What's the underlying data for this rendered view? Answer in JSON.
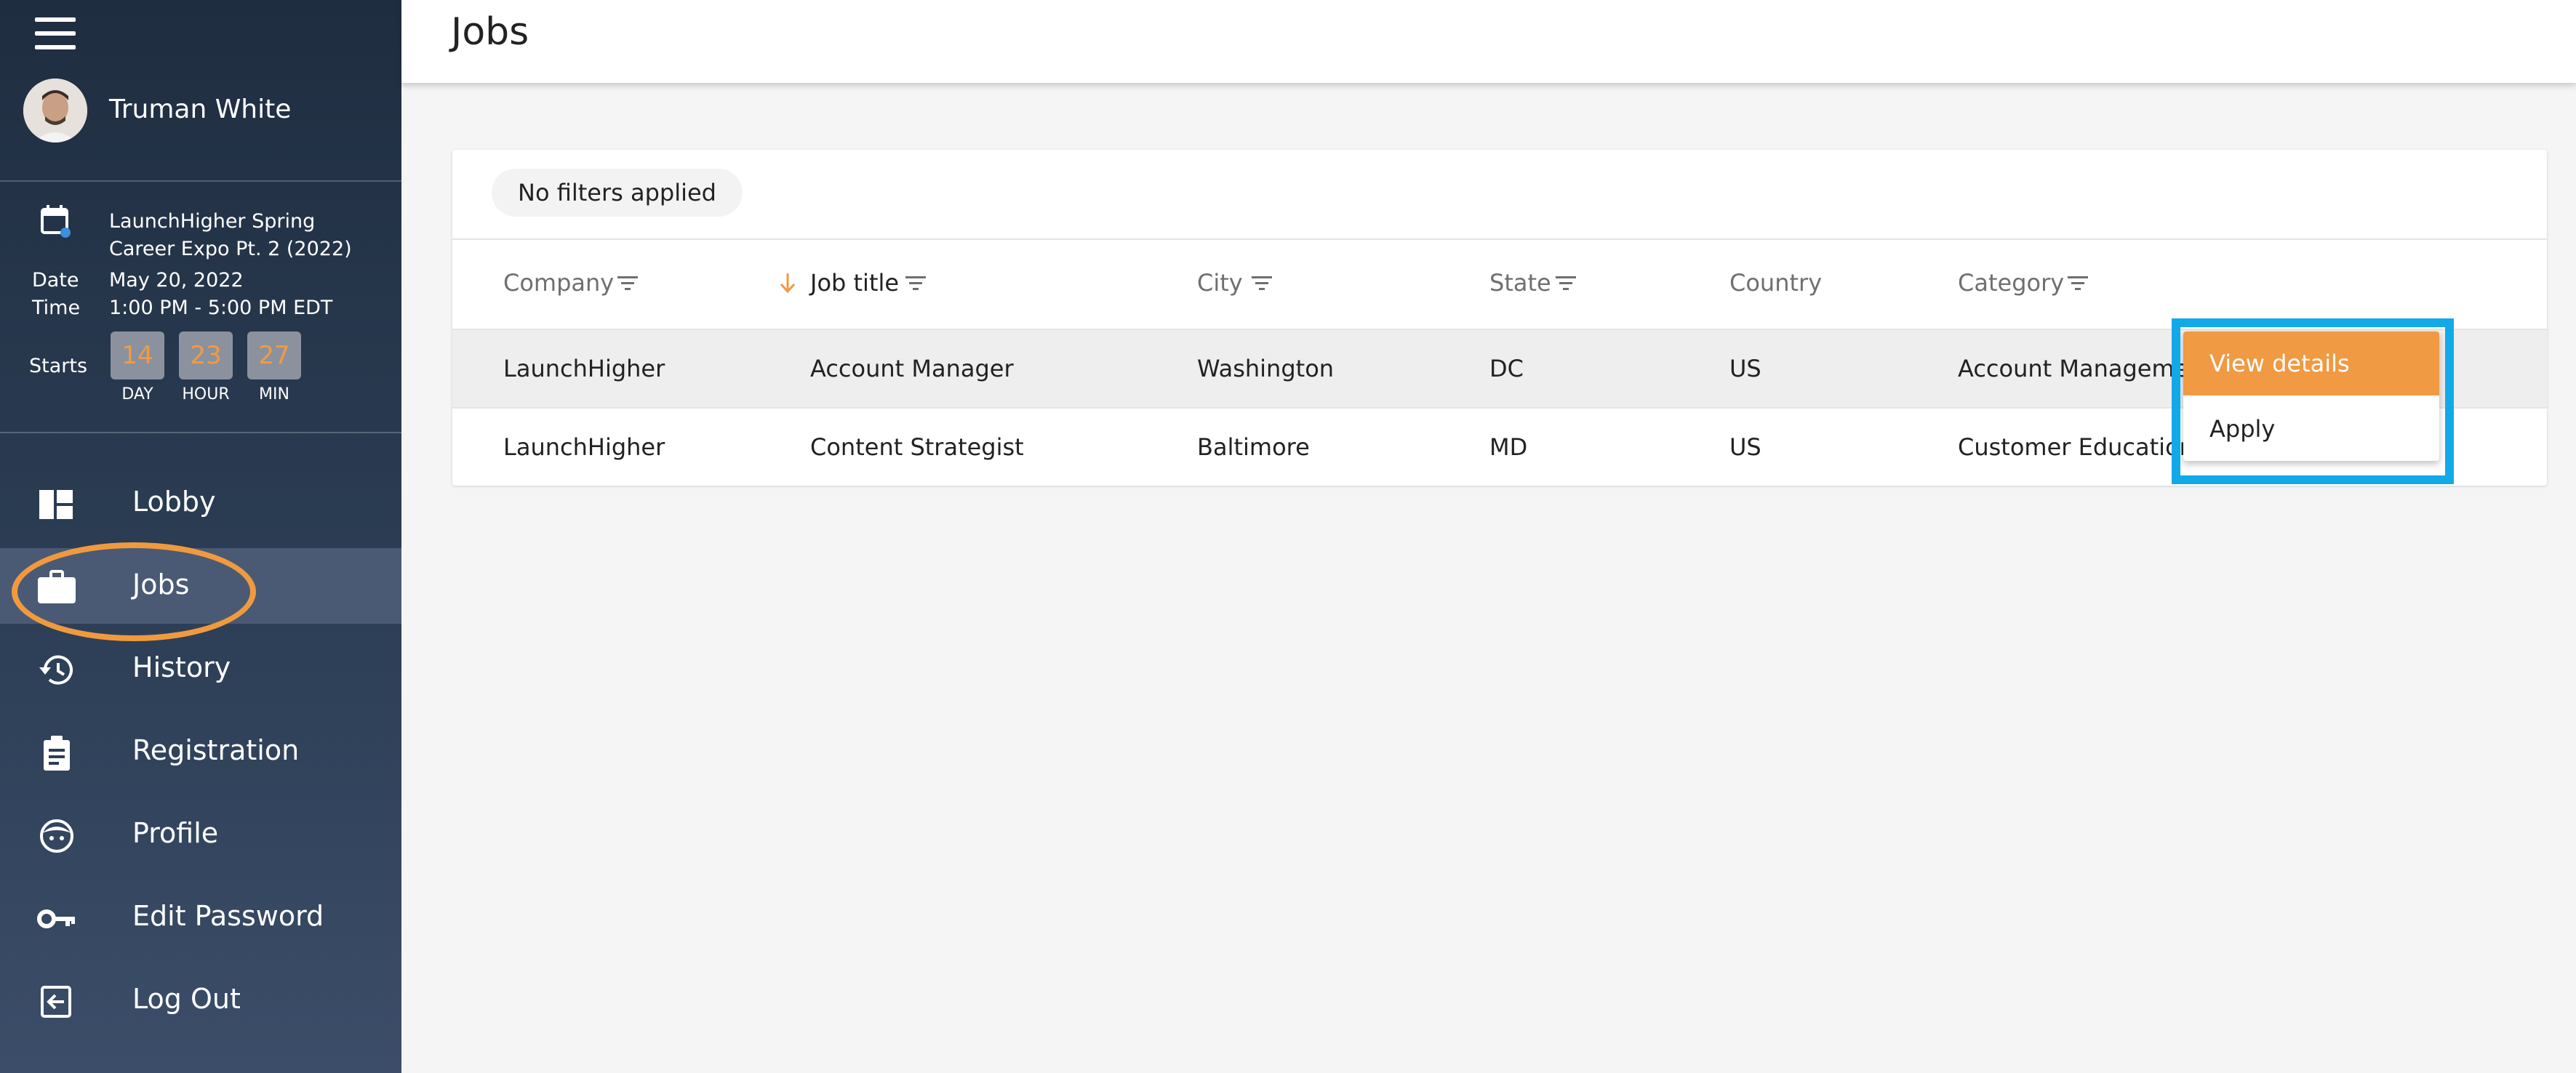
{
  "user": {
    "name": "Truman White"
  },
  "event": {
    "name": "LaunchHigher Spring Career Expo Pt. 2 (2022)",
    "date_label": "Date",
    "date_value": "May 20, 2022",
    "time_label": "Time",
    "time_value": "1:00 PM - 5:00 PM EDT",
    "starts_label": "Starts",
    "countdown": [
      {
        "value": "14",
        "unit": "DAY"
      },
      {
        "value": "23",
        "unit": "HOUR"
      },
      {
        "value": "27",
        "unit": "MIN"
      }
    ]
  },
  "nav": {
    "items": [
      {
        "label": "Lobby",
        "icon": "dashboard-icon"
      },
      {
        "label": "Jobs",
        "icon": "briefcase-icon"
      },
      {
        "label": "History",
        "icon": "history-icon"
      },
      {
        "label": "Registration",
        "icon": "clipboard-icon"
      },
      {
        "label": "Profile",
        "icon": "face-icon"
      },
      {
        "label": "Edit Password",
        "icon": "key-icon"
      },
      {
        "label": "Log Out",
        "icon": "logout-icon"
      }
    ],
    "active": "Jobs"
  },
  "header": {
    "title": "Jobs"
  },
  "filters": {
    "chip_label": "No filters applied"
  },
  "table": {
    "columns": [
      "Company",
      "Job title",
      "City",
      "State",
      "Country",
      "Category"
    ],
    "rows": [
      [
        "LaunchHigher",
        "Account Manager",
        "Washington",
        "DC",
        "US",
        "Account Manageme"
      ],
      [
        "LaunchHigher",
        "Content Strategist",
        "Baltimore",
        "MD",
        "US",
        "Customer Education"
      ]
    ]
  },
  "row_menu": {
    "items": [
      "View details",
      "Apply"
    ]
  },
  "colors": {
    "accent": "#f09a44",
    "highlight_box": "#12a9e8",
    "sidebar": "#2c3e55"
  }
}
